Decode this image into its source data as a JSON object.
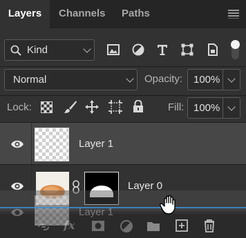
{
  "tabs": [
    {
      "label": "Layers",
      "active": true
    },
    {
      "label": "Channels",
      "active": false
    },
    {
      "label": "Paths",
      "active": false
    }
  ],
  "filter": {
    "kind_label": "Kind",
    "icons": [
      "image-filter-icon",
      "adjustment-filter-icon",
      "type-filter-icon",
      "shape-filter-icon",
      "smart-object-filter-icon"
    ]
  },
  "blend": {
    "mode": "Normal",
    "opacity_label": "Opacity:",
    "opacity_value": "100%"
  },
  "lock": {
    "label": "Lock:",
    "fill_label": "Fill:",
    "fill_value": "100%"
  },
  "layers": [
    {
      "name": "Layer 1",
      "selected": true,
      "visible": true
    },
    {
      "name": "Layer 0",
      "selected": false,
      "visible": true,
      "has_mask": true
    },
    {
      "name": "Layer 1",
      "dragging": true
    }
  ],
  "bottom_icons": [
    "link-layers-icon",
    "fx-icon",
    "add-mask-icon",
    "adjustment-layer-icon",
    "new-group-icon",
    "new-layer-icon",
    "delete-layer-icon"
  ],
  "colors": {
    "panel": "#323232",
    "tabbar": "#252525",
    "selected_row": "#474747",
    "drop_line": "#3b8fd6"
  }
}
